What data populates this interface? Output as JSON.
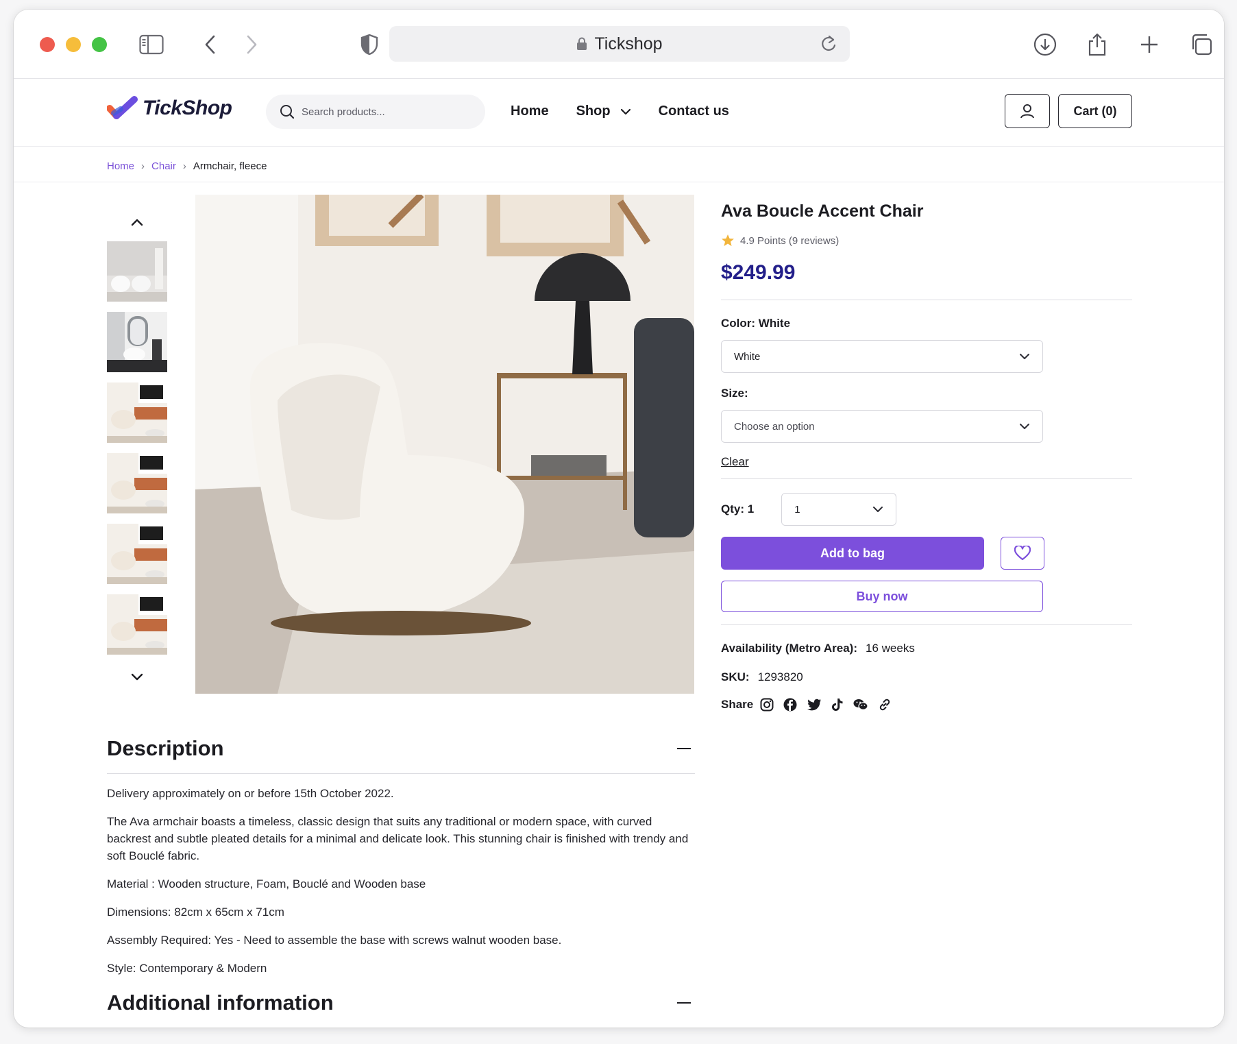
{
  "browser": {
    "url_text": "Tickshop"
  },
  "header": {
    "logo_text": "TickShop",
    "search_placeholder": "Search products...",
    "nav": [
      "Home",
      "Shop",
      "Contact us"
    ],
    "cart_label": "Cart (0)"
  },
  "breadcrumb": {
    "items": [
      "Home",
      "Chair"
    ],
    "current": "Armchair, fleece"
  },
  "product": {
    "title": "Ava Boucle Accent Chair",
    "rating_text": "4.9 Points (9 reviews)",
    "price": "$249.99",
    "color_label": "Color: White",
    "color_value": "White",
    "size_label": "Size:",
    "size_placeholder": "Choose an option",
    "clear_label": "Clear",
    "qty_label": "Qty: 1",
    "qty_value": "1",
    "add_to_bag": "Add to bag",
    "buy_now": "Buy now",
    "availability_label": "Availability (Metro Area):",
    "availability_value": "16 weeks",
    "sku_label": "SKU:",
    "sku_value": "1293820",
    "share_label": "Share"
  },
  "description": {
    "title": "Description",
    "paragraphs": [
      "Delivery approximately on or before 15th October 2022.",
      "The Ava armchair boasts a timeless, classic design that suits any traditional or modern space, with curved backrest and subtle pleated details for a minimal and delicate look. This stunning chair is finished with trendy and soft Bouclé fabric.",
      "Material : Wooden structure, Foam, Bouclé and Wooden base",
      "Dimensions: 82cm x 65cm x 71cm",
      "Assembly Required: Yes - Need to assemble the base with screws  walnut wooden base.",
      "Style: Contemporary & Modern"
    ]
  },
  "additional": {
    "title": "Additional information"
  },
  "colors": {
    "accent": "#7c4fdc",
    "price": "#231f8a",
    "link": "#7b52d8"
  }
}
